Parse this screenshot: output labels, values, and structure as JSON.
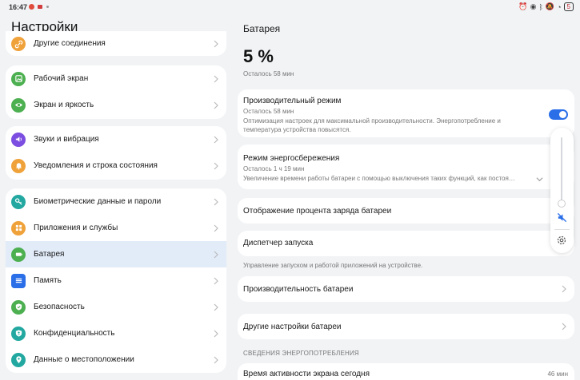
{
  "status": {
    "time": "16:47",
    "battery": "5"
  },
  "left": {
    "title": "Настройки",
    "groups": [
      [
        {
          "label": "Другие соединения",
          "icon": "link-icon",
          "color": "#f0a23a"
        }
      ],
      [
        {
          "label": "Рабочий экран",
          "icon": "image-icon",
          "color": "#4caf50"
        },
        {
          "label": "Экран и яркость",
          "icon": "eye-icon",
          "color": "#4caf50"
        }
      ],
      [
        {
          "label": "Звуки и вибрация",
          "icon": "speaker-icon",
          "color": "#7b4de0"
        },
        {
          "label": "Уведомления и строка состояния",
          "icon": "bell-icon",
          "color": "#f0a23a"
        }
      ],
      [
        {
          "label": "Биометрические данные и пароли",
          "icon": "key-icon",
          "color": "#22a8a0"
        },
        {
          "label": "Приложения и службы",
          "icon": "apps-icon",
          "color": "#f0a23a"
        },
        {
          "label": "Батарея",
          "icon": "battery-icon",
          "color": "#4caf50",
          "selected": true
        },
        {
          "label": "Память",
          "icon": "memory-icon",
          "color": "#2a6ee8"
        },
        {
          "label": "Безопасность",
          "icon": "shield-icon",
          "color": "#4caf50"
        },
        {
          "label": "Конфиденциальность",
          "icon": "privacy-icon",
          "color": "#22a8a0"
        },
        {
          "label": "Данные о местоположении",
          "icon": "location-icon",
          "color": "#22a8a0"
        }
      ]
    ]
  },
  "right": {
    "title": "Батарея",
    "percent": "5 %",
    "remaining": "Осталось 58 мин",
    "perf_mode": {
      "title": "Производительный режим",
      "sub": "Осталось 58 мин",
      "desc": "Оптимизация настроек для максимальной производительности. Энергопотребление и температура устройства повысятся.",
      "enabled": true
    },
    "power_saving": {
      "title": "Режим энергосбережения",
      "sub": "Осталось 1 ч 19 мин",
      "desc": "Увеличение времени работы батареи с помощью выключения таких функций, как постоя…"
    },
    "show_percent": "Отображение процента заряда батареи",
    "launch_manager": "Диспетчер запуска",
    "launch_note": "Управление запуском и работой приложений на устройстве.",
    "battery_perf": "Производительность батареи",
    "other_settings": "Другие настройки батареи",
    "section_header": "СВЕДЕНИЯ ЭНЕРГОПОТРЕБЛЕНИЯ",
    "screen_time": {
      "label": "Время активности экрана сегодня",
      "value": "46 мин"
    }
  },
  "colors": {
    "accent": "#2a6ee8",
    "selected_bg": "#e2ecf9"
  }
}
